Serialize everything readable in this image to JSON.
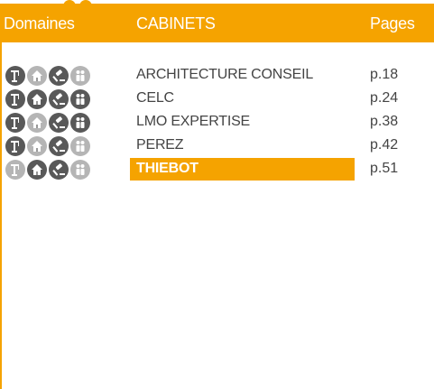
{
  "header": {
    "domaines_label": "Domaines",
    "cabinets_label": "CABINETS",
    "pages_label": "Pages"
  },
  "colors": {
    "accent": "#f5a300",
    "icon_active": "#595959",
    "icon_inactive": "#b5b5b5",
    "text": "#444444"
  },
  "domain_icons": [
    "crane-icon",
    "house-icon",
    "gavel-icon",
    "people-icon"
  ],
  "rows": [
    {
      "name": "ARCHITECTURE CONSEIL",
      "page": "p.18",
      "icons_active": [
        true,
        false,
        true,
        false
      ],
      "selected": false
    },
    {
      "name": "CELC",
      "page": "p.24",
      "icons_active": [
        true,
        true,
        true,
        true
      ],
      "selected": false
    },
    {
      "name": "LMO EXPERTISE",
      "page": "p.38",
      "icons_active": [
        true,
        false,
        true,
        true
      ],
      "selected": false
    },
    {
      "name": "PEREZ",
      "page": "p.42",
      "icons_active": [
        true,
        false,
        true,
        false
      ],
      "selected": false
    },
    {
      "name": "THIEBOT",
      "page": "p.51",
      "icons_active": [
        false,
        true,
        true,
        false
      ],
      "selected": true
    }
  ]
}
